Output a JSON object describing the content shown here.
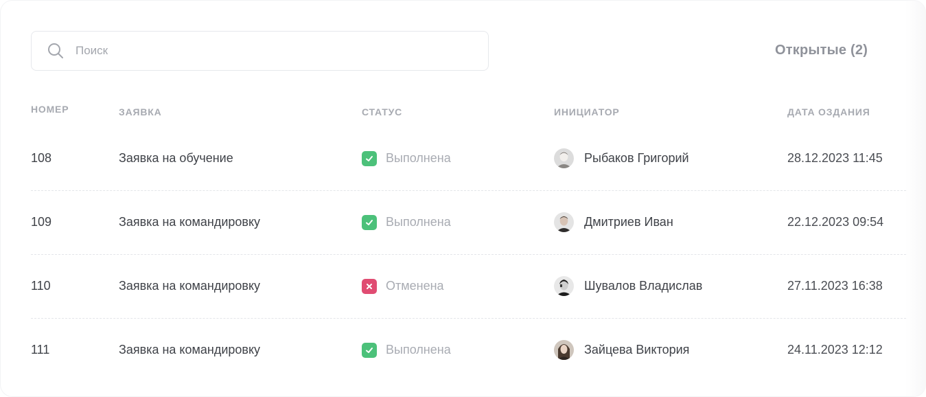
{
  "search": {
    "placeholder": "Поиск",
    "value": ""
  },
  "tab": {
    "label": "Открытые (2)"
  },
  "columns": {
    "number": "НОМЕР",
    "request": "ЗАЯВКА",
    "status": "СТАТУС",
    "initiator": "ИНИЦИАТОР",
    "date": "ДАТА ОЗДАНИЯ"
  },
  "rows": [
    {
      "number": "108",
      "request": "Заявка на обучение",
      "status": "Выполнена",
      "status_kind": "done",
      "initiator": "Рыбаков Григорий",
      "date": "28.12.2023 11:45"
    },
    {
      "number": "109",
      "request": "Заявка на командировку",
      "status": "Выполнена",
      "status_kind": "done",
      "initiator": "Дмитриев Иван",
      "date": "22.12.2023 09:54"
    },
    {
      "number": "110",
      "request": "Заявка на командировку",
      "status": "Отменена",
      "status_kind": "cancel",
      "initiator": "Шувалов Владислав",
      "date": "27.11.2023 16:38"
    },
    {
      "number": "111",
      "request": "Заявка на командировку",
      "status": "Выполнена",
      "status_kind": "done",
      "initiator": "Зайцева Виктория",
      "date": "24.11.2023 12:12"
    }
  ],
  "colors": {
    "status_done": "#4cc17a",
    "status_cancel": "#e04c72",
    "header_text": "#a7aab1",
    "body_text": "#3f4248"
  },
  "icons": {
    "search": "search-icon",
    "done": "check-icon",
    "cancel": "x-icon"
  }
}
